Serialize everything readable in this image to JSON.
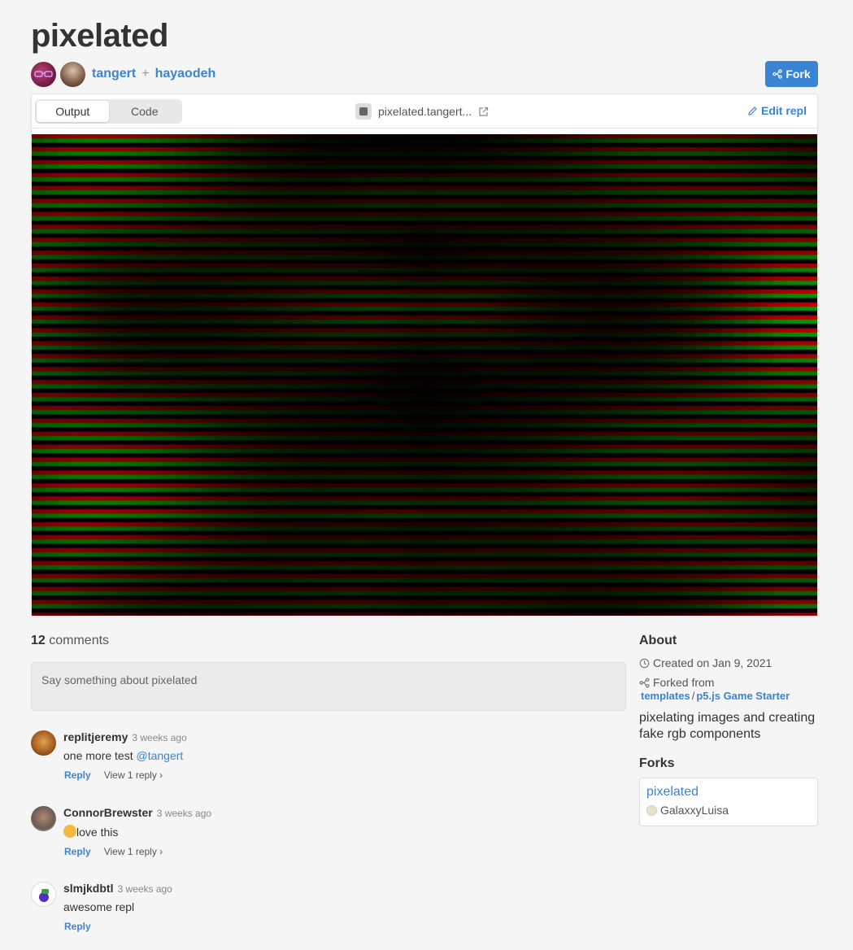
{
  "repl": {
    "title": "pixelated",
    "authors": [
      "tangert",
      "hayaodeh"
    ],
    "plus": "+",
    "fork_label": "Fork"
  },
  "toolbar": {
    "tabs": [
      {
        "label": "Output",
        "active": true
      },
      {
        "label": "Code",
        "active": false
      }
    ],
    "url": "pixelated.tangert...",
    "edit_label": "Edit repl"
  },
  "comments": {
    "count": "12",
    "count_label": "comments",
    "placeholder": "Say something about pixelated",
    "items": [
      {
        "user": "replitjeremy",
        "time": "3 weeks ago",
        "text": "one more test ",
        "mention": "@tangert",
        "reply": "Reply",
        "view": "View 1 reply ›"
      },
      {
        "user": "ConnorBrewster",
        "time": "3 weeks ago",
        "text": "love this",
        "reply": "Reply",
        "view": "View 1 reply ›"
      },
      {
        "user": "slmjkdbtl",
        "time": "3 weeks ago",
        "text": "awesome repl",
        "reply": "Reply"
      }
    ]
  },
  "about": {
    "title": "About",
    "created": "Created on Jan 9, 2021",
    "forked_from": "Forked from",
    "template_owner": "templates",
    "separator": "/",
    "template_name": "p5.js Game Starter",
    "description": "pixelating images and creating fake rgb components",
    "forks_title": "Forks",
    "fork": {
      "name": "pixelated",
      "owner": "GalaxxyLuisa"
    }
  },
  "colors": {
    "accent": "#3a84d6",
    "background": "#f5f5f5"
  }
}
